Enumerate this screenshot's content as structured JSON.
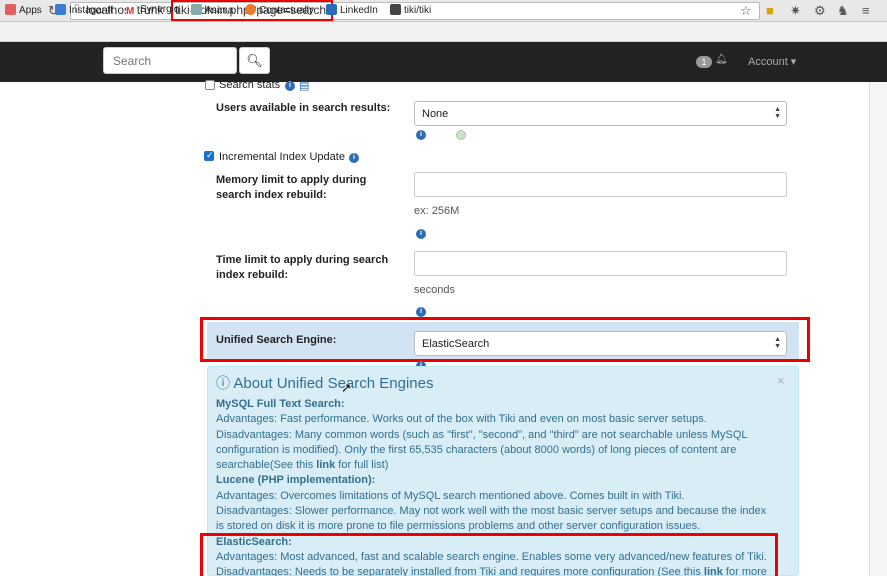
{
  "browser": {
    "url_host": "localhost/trunk",
    "url_path": "tiki-admin.php?page=search",
    "bookmarks": [
      "Apps",
      "Instagantt",
      "Synergiq",
      "Asana",
      "Contactually",
      "LinkedIn",
      "tiki/tiki"
    ]
  },
  "navbar": {
    "search_placeholder": "Search",
    "notification_count": "1",
    "account_label": "Account ▾"
  },
  "form": {
    "search_stats_label": "Search stats",
    "users_available_label": "Users available in search results:",
    "users_available_value": "None",
    "incremental_label": "Incremental Index Update",
    "memory_limit_label": "Memory limit to apply during search index rebuild:",
    "memory_limit_label_l1": "Memory limit to apply during",
    "memory_limit_label_l2": "search index rebuild:",
    "memory_limit_hint": "ex: 256M",
    "time_limit_label_l1": "Time limit to apply during search",
    "time_limit_label_l2": "index rebuild:",
    "time_limit_hint": "seconds",
    "engine_label": "Unified Search Engine:",
    "engine_value": "ElasticSearch"
  },
  "about": {
    "title": "About Unified Search Engines",
    "close": "×",
    "mysql_heading": "MySQL Full Text Search:",
    "mysql_adv": "Advantages: Fast performance. Works out of the box with Tiki and even on most basic server setups.",
    "mysql_dis_1": "Disadvantages: Many common words (such as \"first\", \"second\", and \"third\" are not searchable unless MySQL",
    "mysql_dis_2": "configuration is modified). Only the first 65,535 characters (about 8000 words) of long pieces of content are",
    "mysql_dis_3a": "searchable(See this ",
    "mysql_dis_3link": "link",
    "mysql_dis_3b": " for full list)",
    "lucene_heading": "Lucene (PHP implementation):",
    "lucene_adv": "Advantages: Overcomes limitations of MySQL search mentioned above. Comes built in with Tiki.",
    "lucene_dis_1": "Disadvantages: Slower performance. May not work well with the most basic server setups and because the index",
    "lucene_dis_2": "is stored on disk it is more prone to file permissions problems and other server configuration issues.",
    "es_heading": "ElasticSearch:",
    "es_adv": "Advantages: Most advanced, fast and scalable search engine. Enables some very advanced/new features of Tiki.",
    "es_dis_a": "Disadvantages: Needs to be separately installed from Tiki and requires more configuration (See this ",
    "es_dis_link": "link",
    "es_dis_b": " for more"
  }
}
